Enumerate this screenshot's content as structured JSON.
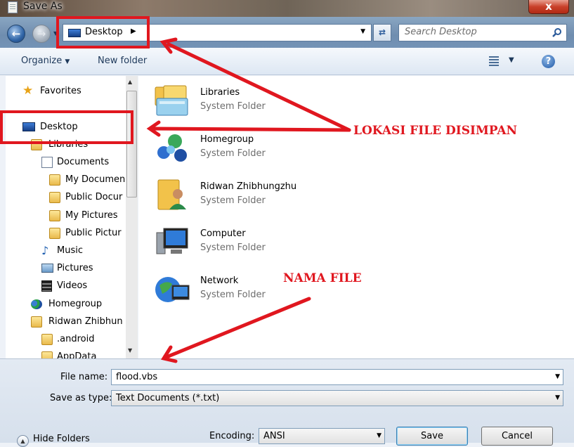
{
  "window": {
    "title": "Save As",
    "close_label": "x"
  },
  "nav": {
    "back_icon": "back-arrow-icon",
    "forward_icon": "forward-arrow-icon",
    "address": {
      "location": "Desktop",
      "icon": "desktop-icon"
    },
    "refresh_icon": "refresh-icon",
    "search_placeholder": "Search Desktop"
  },
  "toolbar": {
    "organize_label": "Organize",
    "new_folder_label": "New folder",
    "views_icon": "views-icon",
    "help_icon": "help-icon"
  },
  "tree": {
    "favorites": "Favorites",
    "desktop": "Desktop",
    "libraries": "Libraries",
    "documents": "Documents",
    "my_documents": "My Documen",
    "public_documents": "Public Docur",
    "my_pictures": "My Pictures",
    "public_pictures": "Public Pictur",
    "music": "Music",
    "pictures": "Pictures",
    "videos": "Videos",
    "homegroup": "Homegroup",
    "user": "Ridwan Zhibhun",
    "android": ".android",
    "appdata": "AppData"
  },
  "items": [
    {
      "name": "Libraries",
      "type": "System Folder",
      "icon": "libraries-icon"
    },
    {
      "name": "Homegroup",
      "type": "System Folder",
      "icon": "homegroup-icon"
    },
    {
      "name": "Ridwan Zhibhungzhu",
      "type": "System Folder",
      "icon": "user-folder-icon"
    },
    {
      "name": "Computer",
      "type": "System Folder",
      "icon": "computer-icon"
    },
    {
      "name": "Network",
      "type": "System Folder",
      "icon": "network-icon"
    }
  ],
  "form": {
    "file_name_label": "File name:",
    "file_name_value": "flood.vbs",
    "save_type_label": "Save as type:",
    "save_type_value": "Text Documents (*.txt)",
    "encoding_label": "Encoding:",
    "encoding_value": "ANSI",
    "save_label": "Save",
    "cancel_label": "Cancel",
    "hide_folders_label": "Hide Folders"
  },
  "annotations": {
    "location": "LOKASI FILE DISIMPAN",
    "file_name": "NAMA FILE",
    "color": "#e0171f"
  }
}
